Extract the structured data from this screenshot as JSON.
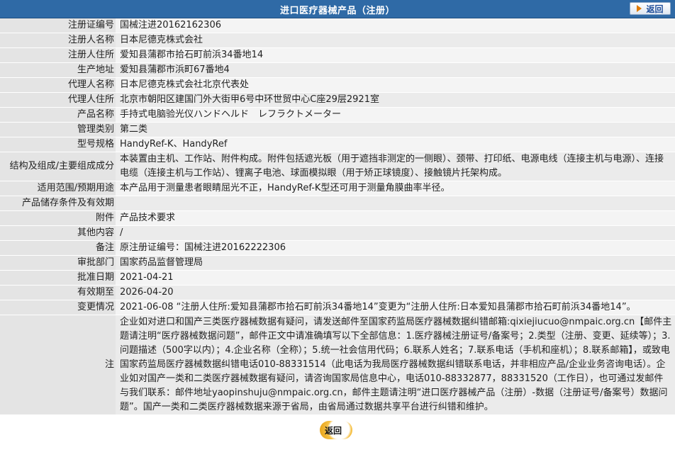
{
  "header": {
    "title": "进口医疗器械产品（注册）",
    "back_label": "返回"
  },
  "rows": [
    {
      "key": "注册证编号",
      "value": "国械注进20162162306"
    },
    {
      "key": "注册人名称",
      "value": "日本尼德克株式会社"
    },
    {
      "key": "注册人住所",
      "value": "爱知县蒲郡市拾石町前浜34番地14"
    },
    {
      "key": "生产地址",
      "value": "爱知县蒲郡市浜町67番地4"
    },
    {
      "key": "代理人名称",
      "value": "日本尼德克株式会社北京代表处"
    },
    {
      "key": "代理人住所",
      "value": "北京市朝阳区建国门外大街甲6号中环世贸中心C座29层2921室"
    },
    {
      "key": "产品名称",
      "value": "手持式电脑验光仪ハンドヘルド　レフラクトメーター"
    },
    {
      "key": "管理类别",
      "value": "第二类"
    },
    {
      "key": "型号规格",
      "value": "HandyRef-K、HandyRef"
    },
    {
      "key": "结构及组成/主要组成成分",
      "value": "本装置由主机、工作站、附件构成。附件包括遮光板（用于遮挡非测定的一侧眼）、颈带、打印纸、电源电线（连接主机与电源）、连接电缆（连接主机与工作站）、锂离子电池、球面模拟眼（用于矫正球镜度）、接触镜片托架构成。"
    },
    {
      "key": "适用范围/预期用途",
      "value": "本产品用于测量患者眼睛屈光不正，HandyRef-K型还可用于测量角膜曲率半径。"
    },
    {
      "key": "产品储存条件及有效期",
      "value": ""
    },
    {
      "key": "附件",
      "value": "产品技术要求"
    },
    {
      "key": "其他内容",
      "value": "/"
    },
    {
      "key": "备注",
      "value": "原注册证编号：国械注进20162222306"
    },
    {
      "key": "审批部门",
      "value": "国家药品监督管理局"
    },
    {
      "key": "批准日期",
      "value": "2021-04-21"
    },
    {
      "key": "有效期至",
      "value": "2026-04-20"
    },
    {
      "key": "变更情况",
      "value": "2021-06-08 “注册人住所:爱知县蒲郡市拾石町前浜34番地14”变更为“注册人住所:日本爱知县蒲郡市拾石町前浜34番地14”。"
    },
    {
      "key": "注",
      "value": "企业如对进口和国产三类医疗器械数据有疑问，请发送邮件至国家药监局医疗器械数据纠错邮箱:qixiejiucuo@nmpaic.org.cn【邮件主题请注明“医疗器械数据问题”，邮件正文中请准确填写以下全部信息：1.医疗器械注册证号/备案号；2.类型（注册、变更、延续等）；3.问题描述（500字以内）；4.企业名称（全称）；5.统一社会信用代码；6.联系人姓名；7.联系电话（手机和座机）；8.联系邮箱】，或致电国家药监局医疗器械数据纠错电话010-88331514（此电话为我局医疗器械数据纠错联系电话，并非相应产品/企业业务咨询电话）。企业如对国产一类和二类医疗器械数据有疑问，请咨询国家局信息中心，电话010-88332877，88331520（工作日），也可通过发邮件与我们联系：邮件地址yaopinshuju@nmpaic.org.cn，邮件主题请注明“进口医疗器械产品（注册）-数据（注册证号/备案号）数据问题”。国产一类和二类医疗器械数据来源于省局，由省局通过数据共享平台进行纠错和维护。"
    }
  ],
  "footer": {
    "back_label": "返回"
  }
}
